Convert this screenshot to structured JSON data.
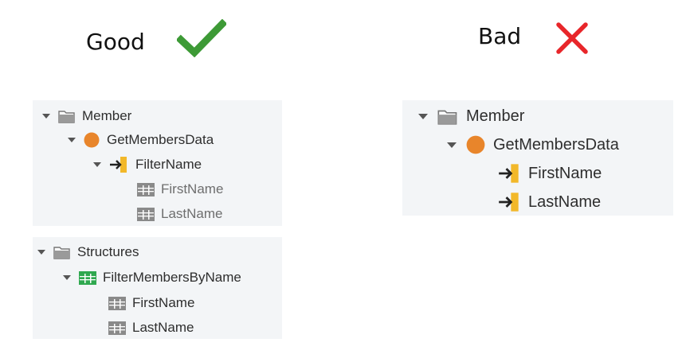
{
  "good": {
    "heading": "Good",
    "mark_icon": "checkmark-icon",
    "mark_color": "#3d9a36",
    "panel1": {
      "rows": [
        {
          "label": "Member",
          "icon": "folder-icon"
        },
        {
          "label": "GetMembersData",
          "icon": "orange-circle-icon"
        },
        {
          "label": "FilterName",
          "icon": "input-parameter-icon"
        },
        {
          "label": "FirstName",
          "icon": "structure-attribute-icon"
        },
        {
          "label": "LastName",
          "icon": "structure-attribute-icon"
        }
      ]
    },
    "panel2": {
      "rows": [
        {
          "label": "Structures",
          "icon": "folder-icon"
        },
        {
          "label": "FilterMembersByName",
          "icon": "structure-icon"
        },
        {
          "label": "FirstName",
          "icon": "structure-attribute-icon"
        },
        {
          "label": "LastName",
          "icon": "structure-attribute-icon"
        }
      ]
    }
  },
  "bad": {
    "heading": "Bad",
    "mark_icon": "cross-icon",
    "mark_color": "#e8262a",
    "panel": {
      "rows": [
        {
          "label": "Member",
          "icon": "folder-icon"
        },
        {
          "label": "GetMembersData",
          "icon": "orange-circle-icon"
        },
        {
          "label": "FirstName",
          "icon": "input-parameter-icon"
        },
        {
          "label": "LastName",
          "icon": "input-parameter-icon"
        }
      ]
    }
  },
  "colors": {
    "panel_bg": "#f3f5f7",
    "action_orange": "#e8852b",
    "input_yellow": "#f2b82a",
    "structure_green": "#2fa84f"
  }
}
